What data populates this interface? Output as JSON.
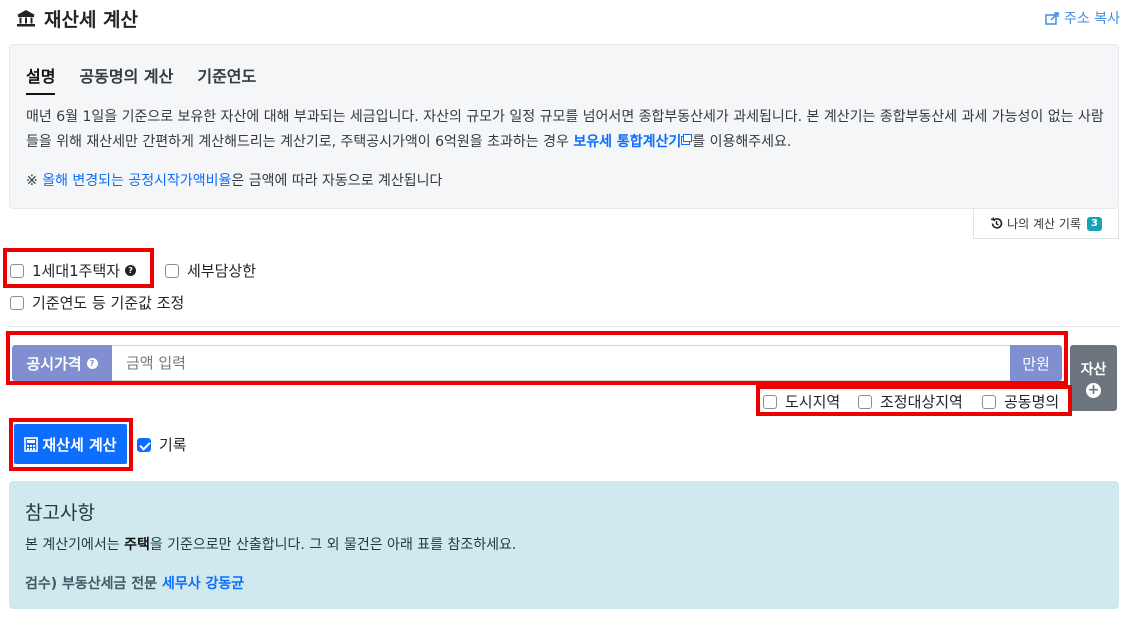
{
  "header": {
    "title": "재산세 계산",
    "copy_label": "주소 복사"
  },
  "info": {
    "tabs": [
      "설명",
      "공동명의 계산",
      "기준연도"
    ],
    "desc_part1": "매년 6월 1일을 기준으로 보유한 자산에 대해 부과되는 세금입니다. 자산의 규모가 일정 규모를 넘어서면 종합부동산세가 과세됩니다. 본 계산기는 종합부동산세 과세 가능성이 없는 사람들을 위해 재산세만 간편하게 계산해드리는 계산기로, 주택공시가액이 6억원을 초과하는 경우 ",
    "desc_link": "보유세 통합계산기",
    "desc_part2": "를 이용해주세요.",
    "note_prefix": "※ ",
    "note_link": "올해 변경되는 공정시작가액비율",
    "note_suffix": "은 금액에 따라 자동으로 계산됩니다"
  },
  "history": {
    "label": "나의 계산 기록",
    "count": "3"
  },
  "options": {
    "one_house": "1세대1주택자",
    "tax_cap": "세부담상한",
    "adjust_base": "기준연도 등 기준값 조정"
  },
  "price": {
    "label": "공시가격",
    "placeholder": "금액 입력",
    "unit": "만원"
  },
  "asset_button": "자산",
  "regions": {
    "city": "도시지역",
    "adjusted": "조정대상지역",
    "joint": "공동명의"
  },
  "calc": {
    "button": "재산세 계산",
    "record_label": "기록"
  },
  "reference": {
    "title": "참고사항",
    "text_prefix": "본 계산기에서는 ",
    "text_bold": "주택",
    "text_suffix": "을 기준으로만 산출합니다. 그 외 물건은 아래 표를 참조하세요.",
    "review_prefix": "검수) 부동산세금 전문 ",
    "review_link": "세무사 강동균"
  },
  "colors": {
    "accent": "#0d6efd",
    "label_bg": "#7f8fcf",
    "ref_bg": "#cfe9ef",
    "frame": "#ee0000"
  }
}
